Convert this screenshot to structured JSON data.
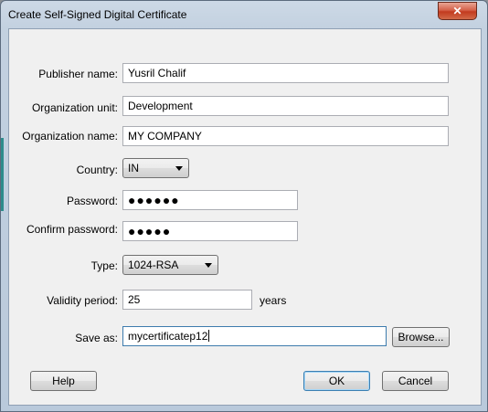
{
  "window": {
    "title": "Create Self-Signed Digital Certificate",
    "close_glyph": "✕"
  },
  "form": {
    "publisher_name": {
      "label": "Publisher name:",
      "value": "Yusril Chalif"
    },
    "organization_unit": {
      "label": "Organization unit:",
      "value": "Development"
    },
    "organization_name": {
      "label": "Organization name:",
      "value": "MY COMPANY"
    },
    "country": {
      "label": "Country:",
      "value": "IN"
    },
    "password": {
      "label": "Password:",
      "mask": "●●●●●●"
    },
    "confirm_password": {
      "label": "Confirm password:",
      "mask": "●●●●●"
    },
    "type": {
      "label": "Type:",
      "value": "1024-RSA"
    },
    "validity_period": {
      "label": "Validity period:",
      "value": "25",
      "unit": "years"
    },
    "save_as": {
      "label": "Save as:",
      "value": "mycertificatep12"
    }
  },
  "buttons": {
    "browse": "Browse...",
    "help": "Help",
    "ok": "OK",
    "cancel": "Cancel"
  },
  "icons": {
    "close": "close-icon",
    "dropdown": "chevron-down-icon"
  }
}
